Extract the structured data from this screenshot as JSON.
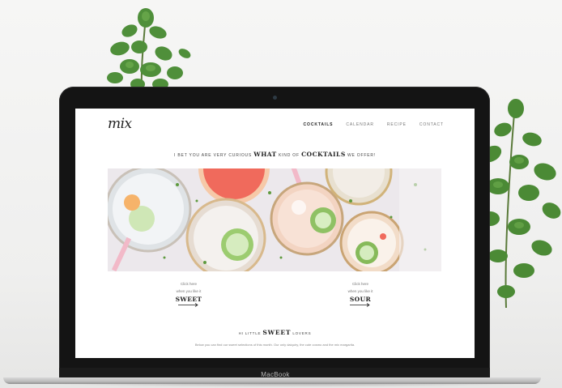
{
  "device": {
    "brand": "MacBook"
  },
  "site": {
    "logo": "mix",
    "nav": [
      {
        "label": "COCKTAILS",
        "active": true
      },
      {
        "label": "CALENDAR",
        "active": false
      },
      {
        "label": "RECIPE",
        "active": false
      },
      {
        "label": "CONTACT",
        "active": false
      }
    ],
    "tagline": {
      "pre": "I BET YOU ARE VERY CURIOUS",
      "em1": "WHAT",
      "mid": "KIND OF",
      "em2": "COCKTAILS",
      "post": "WE OFFER!"
    },
    "ctas": [
      {
        "line1": "Click here",
        "line2": "when you like it",
        "word": "SWEET"
      },
      {
        "line1": "Click here",
        "line2": "when you like it",
        "word": "SOUR"
      }
    ],
    "section": {
      "pre": "HI LITTLE",
      "em": "SWEET",
      "post": "LOVERS",
      "description": "Below you can find our sweet selections of this month. Our only daiquiry, the cute cosmo and the mix margarita."
    }
  },
  "colors": {
    "accent": "#222222",
    "leaf": "#4f8f3a",
    "grapefruit": "#f06a5c",
    "cucumber": "#7cb35a"
  }
}
